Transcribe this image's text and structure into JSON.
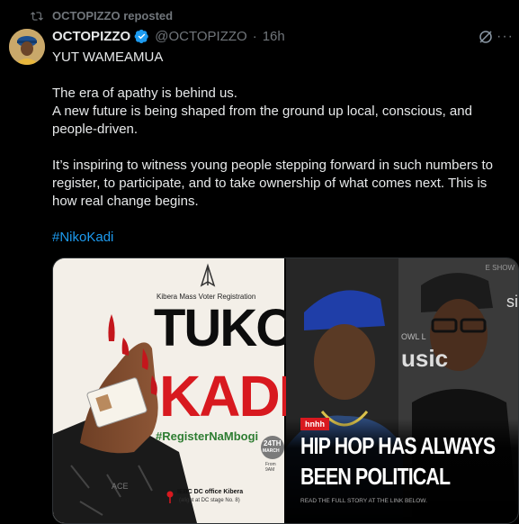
{
  "repost": {
    "label": "OCTOPIZZO reposted"
  },
  "author": {
    "name": "OCTOPIZZO",
    "handle": "@OCTOPIZZO",
    "sep": "·",
    "time": "16h"
  },
  "tweet": {
    "line1": "YUT WAMEAMUA",
    "line2": "The era of apathy is behind us.",
    "line3": "A new future is being shaped from the ground up local, conscious, and people-driven.",
    "line4": "It’s inspiring to witness young people stepping forward in such numbers to register, to participate, and to take ownership of what comes next. This is how real change begins.",
    "hashtag": "#NikoKadi"
  },
  "poster": {
    "subtitle": "Kibera Mass Voter Registration",
    "word1": "TUKO",
    "word2": "KADI",
    "tag": "#RegisterNaMbogi",
    "date_day": "24TH",
    "date_month": "MARCH",
    "from": "From 9AM",
    "venue1": "IEBC DC office Kibera",
    "venue2": "(alight at DC stage No. 8)",
    "card_text": "ACE"
  },
  "article": {
    "badge": "hnhh",
    "headline1": "HIP HOP HAS ALWAYS",
    "headline2": "BEEN POLITICAL",
    "cta": "READ THE FULL STORY AT THE LINK BELOW.",
    "bg_text1": "usic",
    "bg_text2": "si",
    "bg_text3": "E SHOW",
    "bg_text4": "OWL L"
  },
  "colors": {
    "accent": "#1d9bf0",
    "poster_red": "#d8191f",
    "poster_green": "#2e7d32"
  }
}
